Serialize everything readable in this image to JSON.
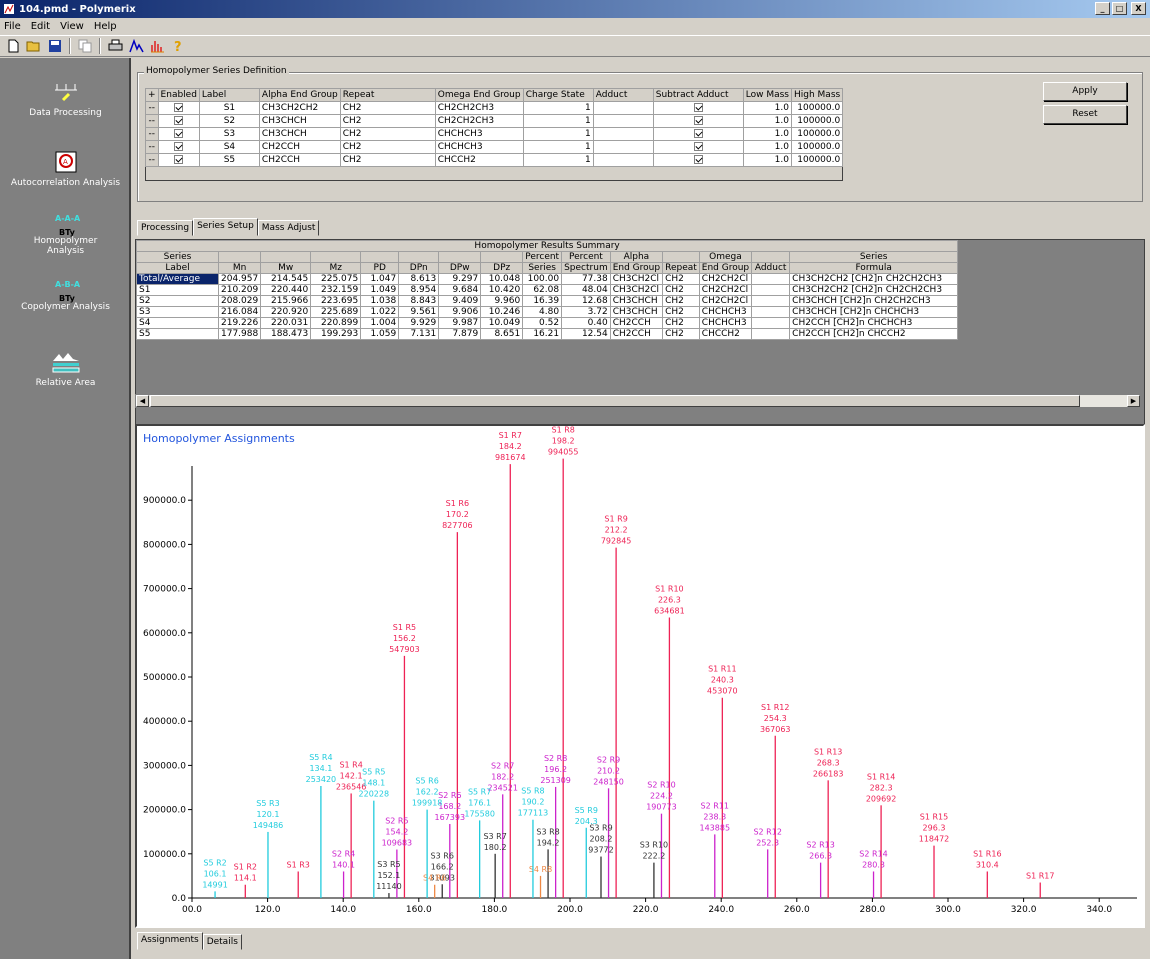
{
  "window": {
    "title": "104.pmd - Polymerix",
    "min": "_",
    "max": "□",
    "close": "X"
  },
  "menu": [
    "File",
    "Edit",
    "View",
    "Help"
  ],
  "sidebar": {
    "items": [
      "Data Processing",
      "Autocorrelation Analysis",
      "Homopolymer Analysis",
      "Copolymer Analysis",
      "Relative Area"
    ],
    "icon_label": "BTy"
  },
  "series_def": {
    "title": "Homopolymer Series Definition",
    "headers": [
      "+",
      "Enabled",
      "Label",
      "Alpha End Group",
      "Repeat",
      "Omega End Group",
      "Charge State",
      "Adduct",
      "Subtract Adduct",
      "Low Mass",
      "High Mass"
    ],
    "rows": [
      {
        "marker": "--",
        "label": "S1",
        "alpha": "CH3CH2CH2",
        "repeat": "CH2",
        "omega": "CH2CH2CH3",
        "charge": "1",
        "adduct": "",
        "low": "1.0",
        "high": "100000.0"
      },
      {
        "marker": "--",
        "label": "S2",
        "alpha": "CH3CHCH",
        "repeat": "CH2",
        "omega": "CH2CH2CH3",
        "charge": "1",
        "adduct": "",
        "low": "1.0",
        "high": "100000.0"
      },
      {
        "marker": "--",
        "label": "S3",
        "alpha": "CH3CHCH",
        "repeat": "CH2",
        "omega": "CHCHCH3",
        "charge": "1",
        "adduct": "",
        "low": "1.0",
        "high": "100000.0"
      },
      {
        "marker": "--",
        "label": "S4",
        "alpha": "CH2CCH",
        "repeat": "CH2",
        "omega": "CHCHCH3",
        "charge": "1",
        "adduct": "",
        "low": "1.0",
        "high": "100000.0"
      },
      {
        "marker": "--",
        "label": "S5",
        "alpha": "CH2CCH",
        "repeat": "CH2",
        "omega": "CHCCH2",
        "charge": "1",
        "adduct": "",
        "low": "1.0",
        "high": "100000.0"
      }
    ]
  },
  "buttons": {
    "apply": "Apply",
    "reset": "Reset"
  },
  "tabs": [
    "Processing",
    "Series Setup",
    "Mass Adjust"
  ],
  "results": {
    "title": "Homopolymer Results Summary",
    "header1": [
      "Series",
      "",
      "",
      "",
      "",
      "",
      "",
      "",
      "Percent",
      "Percent",
      "Alpha",
      "",
      "Omega",
      "",
      "Series"
    ],
    "header2": [
      "Label",
      "Mn",
      "Mw",
      "Mz",
      "PD",
      "DPn",
      "DPw",
      "DPz",
      "Series",
      "Spectrum",
      "End Group",
      "Repeat",
      "End Group",
      "Adduct",
      "Formula"
    ],
    "rows": [
      [
        "Total/Average",
        "204.957",
        "214.545",
        "225.075",
        "1.047",
        "8.613",
        "9.297",
        "10.048",
        "100.00",
        "77.38",
        "CH3CH2Cl",
        "CH2",
        "CH2CH2Cl",
        "",
        "CH3CH2CH2 [CH2]n CH2CH2CH3"
      ],
      [
        "S1",
        "210.209",
        "220.440",
        "232.159",
        "1.049",
        "8.954",
        "9.684",
        "10.420",
        "62.08",
        "48.04",
        "CH3CH2Cl",
        "CH2",
        "CH2CH2Cl",
        "",
        "CH3CH2CH2 [CH2]n CH2CH2CH3"
      ],
      [
        "S2",
        "208.029",
        "215.966",
        "223.695",
        "1.038",
        "8.843",
        "9.409",
        "9.960",
        "16.39",
        "12.68",
        "CH3CHCH",
        "CH2",
        "CH2CH2Cl",
        "",
        "CH3CHCH [CH2]n CH2CH2CH3"
      ],
      [
        "S3",
        "216.084",
        "220.920",
        "225.689",
        "1.022",
        "9.561",
        "9.906",
        "10.246",
        "4.80",
        "3.72",
        "CH3CHCH",
        "CH2",
        "CHCHCH3",
        "",
        "CH3CHCH [CH2]n CHCHCH3"
      ],
      [
        "S4",
        "219.226",
        "220.031",
        "220.899",
        "1.004",
        "9.929",
        "9.987",
        "10.049",
        "0.52",
        "0.40",
        "CH2CCH",
        "CH2",
        "CHCHCH3",
        "",
        "CH2CCH [CH2]n CHCHCH3"
      ],
      [
        "S5",
        "177.988",
        "188.473",
        "199.293",
        "1.059",
        "7.131",
        "7.879",
        "8.651",
        "16.21",
        "12.54",
        "CH2CCH",
        "CH2",
        "CHCCH2",
        "",
        "CH2CCH [CH2]n CHCCH2"
      ]
    ]
  },
  "bottom_tabs": [
    "Assignments",
    "Details"
  ],
  "chart_data": {
    "type": "bar",
    "title": "Homopolymer Assignments",
    "xlim": [
      100,
      350
    ],
    "ylim": [
      0,
      1000000
    ],
    "xticks": [
      100,
      120,
      140,
      160,
      180,
      200,
      220,
      240,
      260,
      280,
      300,
      320,
      340
    ],
    "xtick_labels": [
      "00.0",
      "120.0",
      "140.0",
      "160.0",
      "180.0",
      "200.0",
      "220.0",
      "240.0",
      "260.0",
      "280.0",
      "300.0",
      "320.0",
      "340.0"
    ],
    "yticks": [
      0,
      100000,
      200000,
      300000,
      400000,
      500000,
      600000,
      700000,
      800000,
      900000
    ],
    "ytick_labels": [
      "0.0",
      "100000.0",
      "200000.0",
      "300000.0",
      "400000.0",
      "500000.0",
      "600000.0",
      "700000.0",
      "800000.0",
      "900000.0"
    ],
    "colors": {
      "S1": "#ee2255",
      "S2": "#cc22cc",
      "S3": "#333333",
      "S4": "#ee8844",
      "S5": "#22ccdd"
    },
    "peaks": [
      {
        "series": "S1",
        "label": "S1 R5",
        "mass": "156.2",
        "x": 156.2,
        "y": 547903,
        "value": "547903"
      },
      {
        "series": "S1",
        "label": "S1 R6",
        "mass": "170.2",
        "x": 170.2,
        "y": 827706,
        "value": "827706"
      },
      {
        "series": "S1",
        "label": "S1 R7",
        "mass": "184.2",
        "x": 184.2,
        "y": 981674,
        "value": "981674"
      },
      {
        "series": "S1",
        "label": "S1 R8",
        "mass": "198.2",
        "x": 198.2,
        "y": 994055,
        "value": "994055"
      },
      {
        "series": "S1",
        "label": "S1 R9",
        "mass": "212.2",
        "x": 212.2,
        "y": 792845,
        "value": "792845"
      },
      {
        "series": "S1",
        "label": "S1 R10",
        "mass": "226.3",
        "x": 226.3,
        "y": 634681,
        "value": "634681"
      },
      {
        "series": "S1",
        "label": "S1 R11",
        "mass": "240.3",
        "x": 240.3,
        "y": 453070,
        "value": "453070"
      },
      {
        "series": "S1",
        "label": "S1 R12",
        "mass": "254.3",
        "x": 254.3,
        "y": 367063,
        "value": "367063"
      },
      {
        "series": "S1",
        "label": "S1 R13",
        "mass": "268.3",
        "x": 268.3,
        "y": 266183,
        "value": "266183"
      },
      {
        "series": "S1",
        "label": "S1 R14",
        "mass": "282.3",
        "x": 282.3,
        "y": 209692,
        "value": "209692"
      },
      {
        "series": "S1",
        "label": "S1 R15",
        "mass": "296.3",
        "x": 296.3,
        "y": 118472,
        "value": "118472"
      },
      {
        "series": "S1",
        "label": "S1 R16",
        "mass": "310.4",
        "x": 310.4,
        "y": 60000,
        "value": ""
      },
      {
        "series": "S1",
        "label": "S1 R17",
        "mass": "",
        "x": 324.4,
        "y": 35000,
        "value": ""
      },
      {
        "series": "S1",
        "label": "S1 R4",
        "mass": "142.1",
        "x": 142.1,
        "y": 236546,
        "value": "236546"
      },
      {
        "series": "S1",
        "label": "S1 R3",
        "mass": "",
        "x": 128.1,
        "y": 60000,
        "value": ""
      },
      {
        "series": "S1",
        "label": "S1 R2",
        "mass": "114.1",
        "x": 114.1,
        "y": 30000,
        "value": ""
      },
      {
        "series": "S2",
        "label": "S2 R7",
        "mass": "182.2",
        "x": 182.2,
        "y": 234521,
        "value": "234521"
      },
      {
        "series": "S2",
        "label": "S2 R8",
        "mass": "196.2",
        "x": 196.2,
        "y": 251309,
        "value": "251309"
      },
      {
        "series": "S2",
        "label": "S2 R9",
        "mass": "210.2",
        "x": 210.2,
        "y": 248150,
        "value": "248150"
      },
      {
        "series": "S2",
        "label": "S2 R10",
        "mass": "224.2",
        "x": 224.2,
        "y": 190773,
        "value": "190773"
      },
      {
        "series": "S2",
        "label": "S2 R11",
        "mass": "238.3",
        "x": 238.3,
        "y": 143885,
        "value": "143885"
      },
      {
        "series": "S2",
        "label": "S2 R12",
        "mass": "252.3",
        "x": 252.3,
        "y": 110000,
        "value": ""
      },
      {
        "series": "S2",
        "label": "S2 R13",
        "mass": "266.3",
        "x": 266.3,
        "y": 80000,
        "value": ""
      },
      {
        "series": "S2",
        "label": "S2 R14",
        "mass": "280.3",
        "x": 280.3,
        "y": 60000,
        "value": ""
      },
      {
        "series": "S2",
        "label": "S2 R6",
        "mass": "168.2",
        "x": 168.2,
        "y": 167393,
        "value": "167393"
      },
      {
        "series": "S2",
        "label": "S2 R5",
        "mass": "154.2",
        "x": 154.2,
        "y": 109683,
        "value": "109683"
      },
      {
        "series": "S2",
        "label": "S2 R4",
        "mass": "140.1",
        "x": 140.1,
        "y": 60000,
        "value": ""
      },
      {
        "series": "S3",
        "label": "S3 R7",
        "mass": "180.2",
        "x": 180.2,
        "y": 100000,
        "value": ""
      },
      {
        "series": "S3",
        "label": "S3 R8",
        "mass": "194.2",
        "x": 194.2,
        "y": 110000,
        "value": ""
      },
      {
        "series": "S3",
        "label": "S3 R9",
        "mass": "208.2",
        "x": 208.2,
        "y": 93772,
        "value": "93772"
      },
      {
        "series": "S3",
        "label": "S3 R10",
        "mass": "222.2",
        "x": 222.2,
        "y": 80000,
        "value": ""
      },
      {
        "series": "S3",
        "label": "S3 R6",
        "mass": "166.2",
        "x": 166.2,
        "y": 31093,
        "value": "31093"
      },
      {
        "series": "S3",
        "label": "S3 R5",
        "mass": "152.1",
        "x": 152.1,
        "y": 11140,
        "value": "11140"
      },
      {
        "series": "S4",
        "label": "S4 R8",
        "mass": "",
        "x": 192.2,
        "y": 50000,
        "value": ""
      },
      {
        "series": "S4",
        "label": "S4 R6",
        "mass": "",
        "x": 164.2,
        "y": 30000,
        "value": ""
      },
      {
        "series": "S5",
        "label": "S5 R4",
        "mass": "134.1",
        "x": 134.1,
        "y": 253420,
        "value": "253420"
      },
      {
        "series": "S5",
        "label": "S5 R5",
        "mass": "148.1",
        "x": 148.1,
        "y": 220228,
        "value": "220228"
      },
      {
        "series": "S5",
        "label": "S5 R6",
        "mass": "162.2",
        "x": 162.2,
        "y": 199918,
        "value": "199918"
      },
      {
        "series": "S5",
        "label": "S5 R7",
        "mass": "176.1",
        "x": 176.1,
        "y": 175580,
        "value": "175580"
      },
      {
        "series": "S5",
        "label": "S5 R8",
        "mass": "190.2",
        "x": 190.2,
        "y": 177113,
        "value": "177113"
      },
      {
        "series": "S5",
        "label": "S5 R9",
        "mass": "204.3",
        "x": 204.3,
        "y": 158891,
        "value": ""
      },
      {
        "series": "S5",
        "label": "S5 R3",
        "mass": "120.1",
        "x": 120.1,
        "y": 149486,
        "value": "149486"
      },
      {
        "series": "S5",
        "label": "S5 R2",
        "mass": "106.1",
        "x": 106.1,
        "y": 14991,
        "value": "14991"
      }
    ]
  }
}
